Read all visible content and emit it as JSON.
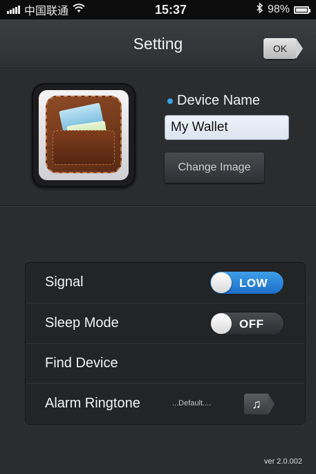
{
  "status_bar": {
    "carrier": "中国联通",
    "time": "15:37",
    "battery": "98%"
  },
  "nav": {
    "title": "Setting",
    "ok_label": "OK"
  },
  "device": {
    "label": "Device Name",
    "name_value": "My Wallet",
    "change_image_label": "Change Image"
  },
  "settings": {
    "signal_label": "Signal",
    "signal_value": "LOW",
    "sleep_label": "Sleep Mode",
    "sleep_value": "OFF",
    "find_label": "Find Device",
    "alarm_label": "Alarm Ringtone",
    "alarm_value": "...Default...."
  },
  "version": "ver 2.0.002",
  "colors": {
    "accent": "#2a86d8",
    "background": "#2b2c2e"
  },
  "icons": {
    "signal": "cell-signal-icon",
    "wifi": "wifi-icon",
    "bluetooth": "bluetooth-icon",
    "battery": "battery-icon",
    "music": "music-note-icon",
    "wallet": "wallet-image"
  }
}
